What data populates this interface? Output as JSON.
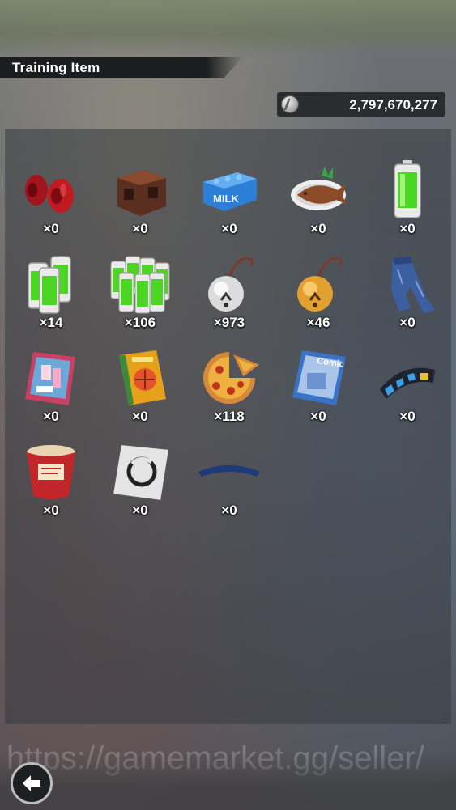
{
  "header": {
    "title": "Training Item"
  },
  "currency": {
    "icon": "coin-icon",
    "value": "2,797,670,277"
  },
  "items": [
    {
      "icon": "red-weights-icon",
      "qty": "×0"
    },
    {
      "icon": "brown-blocks-icon",
      "qty": "×0"
    },
    {
      "icon": "milk-crate-icon",
      "qty": "×0"
    },
    {
      "icon": "grilled-fish-icon",
      "qty": "×0"
    },
    {
      "icon": "battery-single-icon",
      "qty": "×0"
    },
    {
      "icon": "battery-pack-icon",
      "qty": "×14"
    },
    {
      "icon": "battery-bundle-icon",
      "qty": "×106"
    },
    {
      "icon": "silver-bell-icon",
      "qty": "×973"
    },
    {
      "icon": "gold-bell-icon",
      "qty": "×46"
    },
    {
      "icon": "jeans-icon",
      "qty": "×0"
    },
    {
      "icon": "magazine-icon",
      "qty": "×0"
    },
    {
      "icon": "orange-book-icon",
      "qty": "×0"
    },
    {
      "icon": "pizza-icon",
      "qty": "×118"
    },
    {
      "icon": "comic-book-icon",
      "qty": "×0"
    },
    {
      "icon": "headband-icon",
      "qty": "×0"
    },
    {
      "icon": "instant-noodle-cup-icon",
      "qty": "×0"
    },
    {
      "icon": "symbol-card-icon",
      "qty": "×0"
    },
    {
      "icon": "blue-band-icon",
      "qty": "×0"
    }
  ],
  "watermark": "https://gamemarket.gg/seller/",
  "back_button": {
    "icon": "back-arrow-icon"
  }
}
